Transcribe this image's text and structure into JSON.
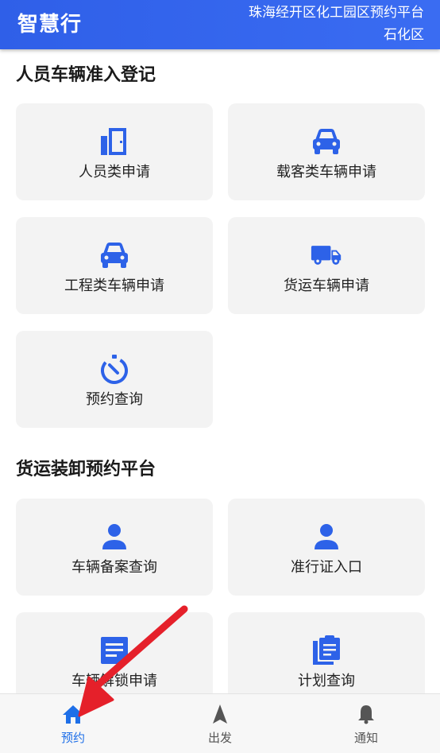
{
  "header": {
    "logo": "智慧行",
    "title_line1": "珠海经开区化工园区预约平台",
    "title_line2": "石化区"
  },
  "sections": [
    {
      "title": "人员车辆准入登记",
      "cards": [
        {
          "label": "人员类申请",
          "icon": "door-icon"
        },
        {
          "label": "载客类车辆申请",
          "icon": "car-icon"
        },
        {
          "label": "工程类车辆申请",
          "icon": "car-icon"
        },
        {
          "label": "货运车辆申请",
          "icon": "truck-icon"
        },
        {
          "label": "预约查询",
          "icon": "timer-icon"
        }
      ]
    },
    {
      "title": "货运装卸预约平台",
      "cards": [
        {
          "label": "车辆备案查询",
          "icon": "person-icon"
        },
        {
          "label": "准行证入口",
          "icon": "person-icon"
        },
        {
          "label": "车辆解锁申请",
          "icon": "document-icon"
        },
        {
          "label": "计划查询",
          "icon": "clipboard-icon"
        }
      ]
    }
  ],
  "tabbar": {
    "items": [
      {
        "label": "预约",
        "icon": "home-icon",
        "active": true
      },
      {
        "label": "出发",
        "icon": "navigation-icon",
        "active": false
      },
      {
        "label": "通知",
        "icon": "bell-icon",
        "active": false
      }
    ]
  },
  "colors": {
    "header": "#3a6cf2",
    "icon": "#2d62e8",
    "card_bg": "#f3f3f3",
    "active_tab": "#1e6fe8",
    "annotation_arrow": "#e5202a"
  }
}
